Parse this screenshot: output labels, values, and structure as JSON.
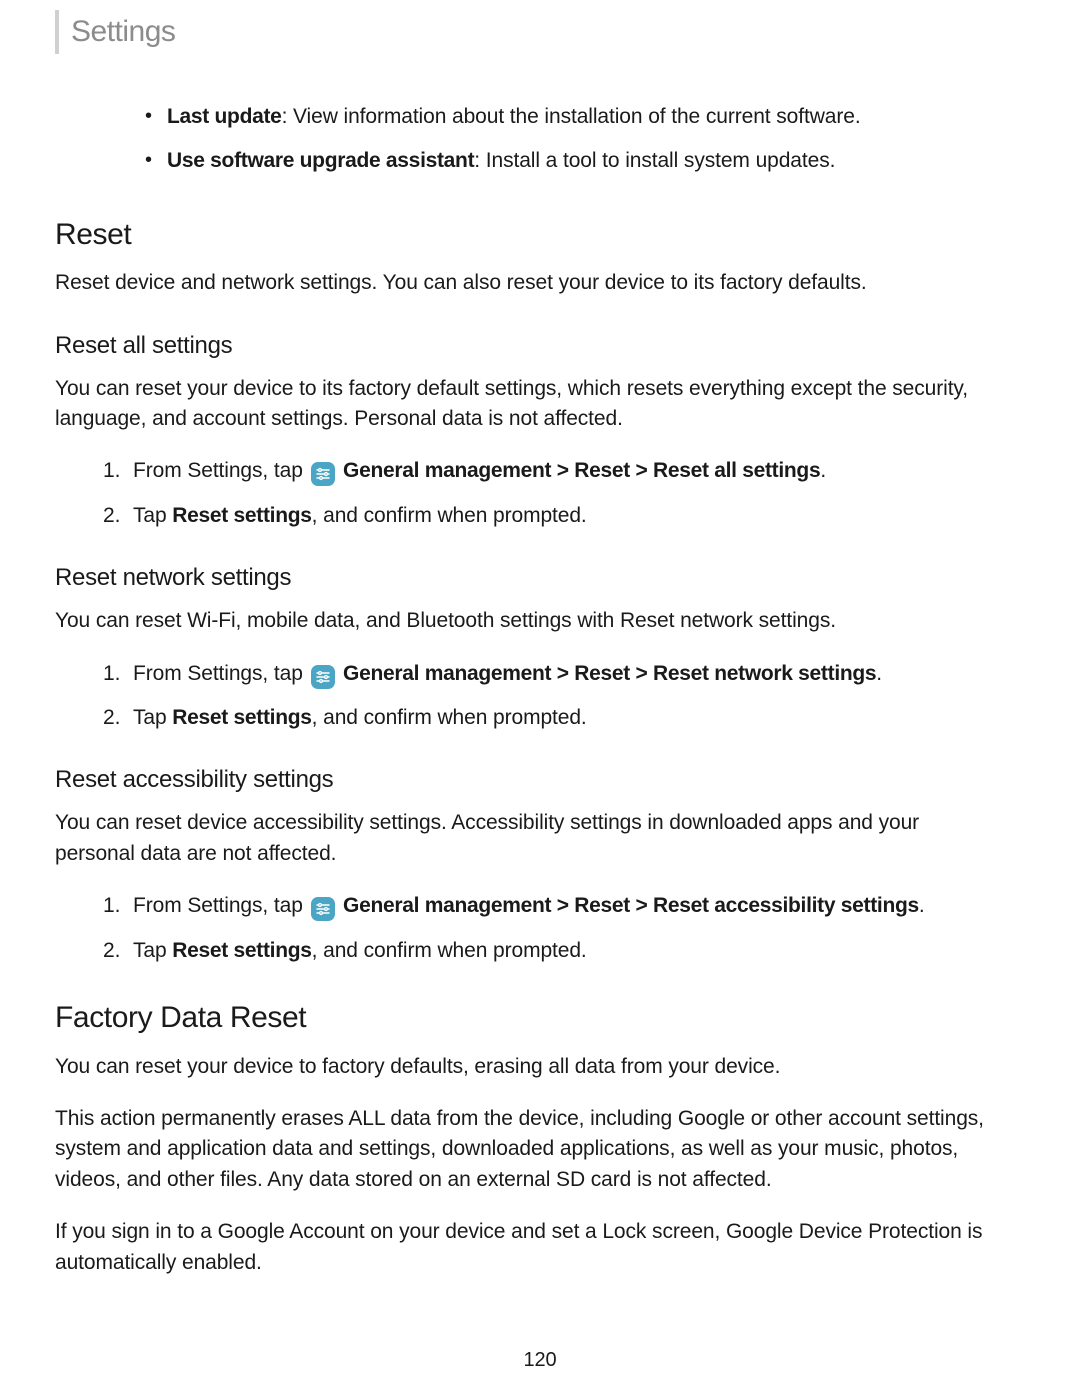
{
  "header": {
    "title": "Settings"
  },
  "top_bullets": [
    {
      "label": "Last update",
      "desc": ": View information about the installation of the current software."
    },
    {
      "label": "Use software upgrade assistant",
      "desc": ": Install a tool to install system updates."
    }
  ],
  "reset": {
    "heading": "Reset",
    "intro": "Reset device and network settings. You can also reset your device to its factory defaults."
  },
  "reset_all": {
    "heading": "Reset all settings",
    "intro": "You can reset your device to its factory default settings, which resets everything except the security, language, and account settings. Personal data is not affected.",
    "step1_prefix": "From Settings, tap ",
    "step1_path": " General management > Reset > Reset all settings",
    "step1_suffix": ".",
    "step2_prefix": "Tap ",
    "step2_bold": "Reset settings",
    "step2_suffix": ", and confirm when prompted."
  },
  "reset_network": {
    "heading": "Reset network settings",
    "intro": "You can reset Wi-Fi, mobile data, and Bluetooth settings with Reset network settings.",
    "step1_prefix": "From Settings, tap ",
    "step1_path": " General management > Reset > Reset network settings",
    "step1_suffix": ".",
    "step2_prefix": "Tap ",
    "step2_bold": "Reset settings",
    "step2_suffix": ", and confirm when prompted."
  },
  "reset_accessibility": {
    "heading": "Reset accessibility settings",
    "intro": "You can reset device accessibility settings. Accessibility settings in downloaded apps and your personal data are not affected.",
    "step1_prefix": "From Settings, tap ",
    "step1_path": " General management > Reset > Reset accessibility settings",
    "step1_suffix": ".",
    "step2_prefix": "Tap ",
    "step2_bold": "Reset settings",
    "step2_suffix": ", and confirm when prompted."
  },
  "factory": {
    "heading": "Factory Data Reset",
    "p1": "You can reset your device to factory defaults, erasing all data from your device.",
    "p2": "This action permanently erases ALL data from the device, including Google or other account settings, system and application data and settings, downloaded applications, as well as your music, photos, videos, and other files. Any data stored on an external SD card is not affected.",
    "p3": "If you sign in to a Google Account on your device and set a Lock screen, Google Device Protection is automatically enabled."
  },
  "page_number": "120",
  "icons": {
    "general_management": "general-management-icon"
  }
}
